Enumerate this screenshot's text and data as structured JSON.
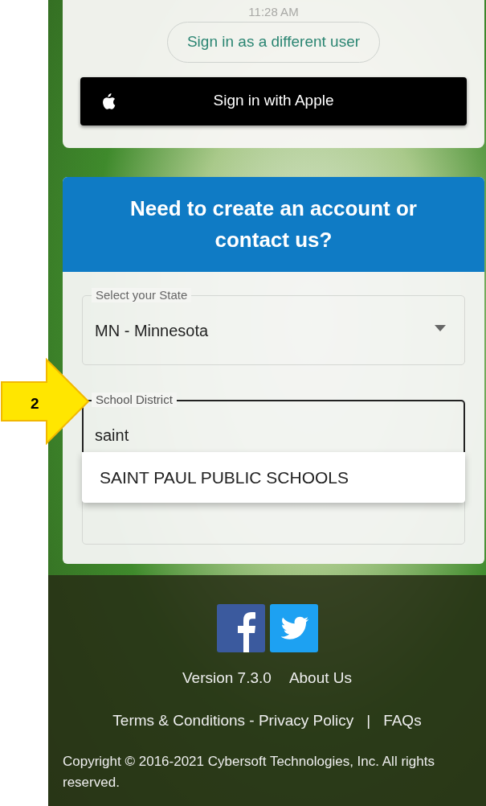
{
  "status_bar": {
    "time": "11:28 AM"
  },
  "sign_in": {
    "different_user_button": "Sign in as a different user",
    "apple_button": "Sign in with Apple"
  },
  "create_account": {
    "title": "Need to create an account or contact us?",
    "fields": [
      {
        "kind": "select",
        "label": "Select your State",
        "value": "MN - Minnesota",
        "focused": false
      },
      {
        "kind": "text",
        "label": "School District",
        "value": "saint",
        "focused": true
      }
    ],
    "suggestions": [
      {
        "label": "SAINT PAUL PUBLIC SCHOOLS"
      }
    ]
  },
  "footer": {
    "version": "Version 7.3.0",
    "about": "About Us",
    "terms": "Terms & Conditions - Privacy Policy",
    "separator": "|",
    "faqs": "FAQs",
    "copyright": "Copyright © 2016-2021 Cybersoft Technologies, Inc. All rights reserved."
  },
  "callout": {
    "label": "2"
  }
}
